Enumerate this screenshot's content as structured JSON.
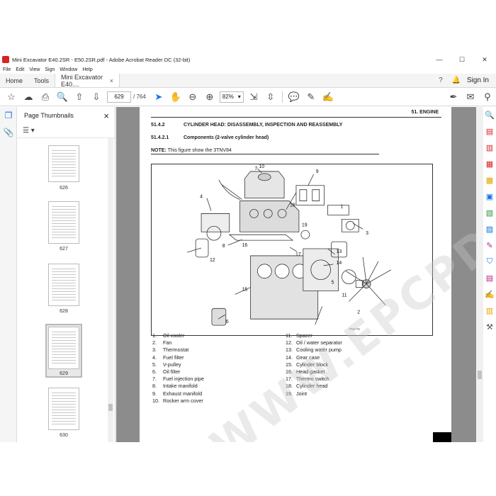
{
  "window": {
    "title": "Mini Excavator E40.2SR - E50.2SR.pdf - Adobe Acrobat Reader DC (32-bit)",
    "controls": [
      "—",
      "☐",
      "✕"
    ]
  },
  "menu": [
    "File",
    "Edit",
    "View",
    "Sign",
    "Window",
    "Help"
  ],
  "tabs": {
    "home": "Home",
    "tools": "Tools",
    "document": "Mini Excavator E40....",
    "close": "×",
    "sign_in": "Sign In"
  },
  "toolbar": {
    "page_current": "629",
    "page_total": "/ 764",
    "zoom": "82%"
  },
  "thumbnails": {
    "title": "Page Thumbnails",
    "close": "×",
    "pages": [
      {
        "label": "626"
      },
      {
        "label": "627"
      },
      {
        "label": "628"
      },
      {
        "label": "629",
        "selected": true
      },
      {
        "label": "630"
      }
    ]
  },
  "document": {
    "chapter": "51. ENGINE",
    "section_num": "51.4.2",
    "section_title": "CYLINDER HEAD: DISASSEMBLY, INSPECTION AND REASSEMBLY",
    "subsection_num": "51.4.2.1",
    "subsection_title": "Components (2-valve cylinder head)",
    "note_label": "NOTE:",
    "note_text": "This figure show the 3TNV84",
    "watermark": "WWW.EPCPDO.COM",
    "figure_labels": [
      "1",
      "2",
      "3",
      "4",
      "5",
      "6",
      "7",
      "8",
      "9",
      "10",
      "11",
      "12",
      "13",
      "14",
      "15",
      "16",
      "17",
      "18",
      "19"
    ],
    "figure_code": "TNV76",
    "legend_left": [
      {
        "n": "1.",
        "t": "Oil cooler"
      },
      {
        "n": "2.",
        "t": "Fan"
      },
      {
        "n": "3.",
        "t": "Thermostat"
      },
      {
        "n": "4.",
        "t": "Fuel filter"
      },
      {
        "n": "5.",
        "t": "V-pulley"
      },
      {
        "n": "6.",
        "t": "Oil filter"
      },
      {
        "n": "7.",
        "t": "Fuel injection pipe"
      },
      {
        "n": "8.",
        "t": "Intake manifold"
      },
      {
        "n": "9.",
        "t": "Exhaust manifold"
      },
      {
        "n": "10.",
        "t": "Rocker arm cover"
      }
    ],
    "legend_right": [
      {
        "n": "11.",
        "t": "Spacer"
      },
      {
        "n": "12.",
        "t": "Oil / water separator"
      },
      {
        "n": "13.",
        "t": "Cooling water pump"
      },
      {
        "n": "14.",
        "t": "Gear case"
      },
      {
        "n": "15.",
        "t": "Cylinder block"
      },
      {
        "n": "16.",
        "t": "Head gasket"
      },
      {
        "n": "17.",
        "t": "Thermo switch"
      },
      {
        "n": "18.",
        "t": "Cylinder head"
      },
      {
        "n": "19.",
        "t": "Joint"
      }
    ]
  },
  "colors": {
    "accent": "#1473e6",
    "doc_background": "#8c8c8c"
  }
}
